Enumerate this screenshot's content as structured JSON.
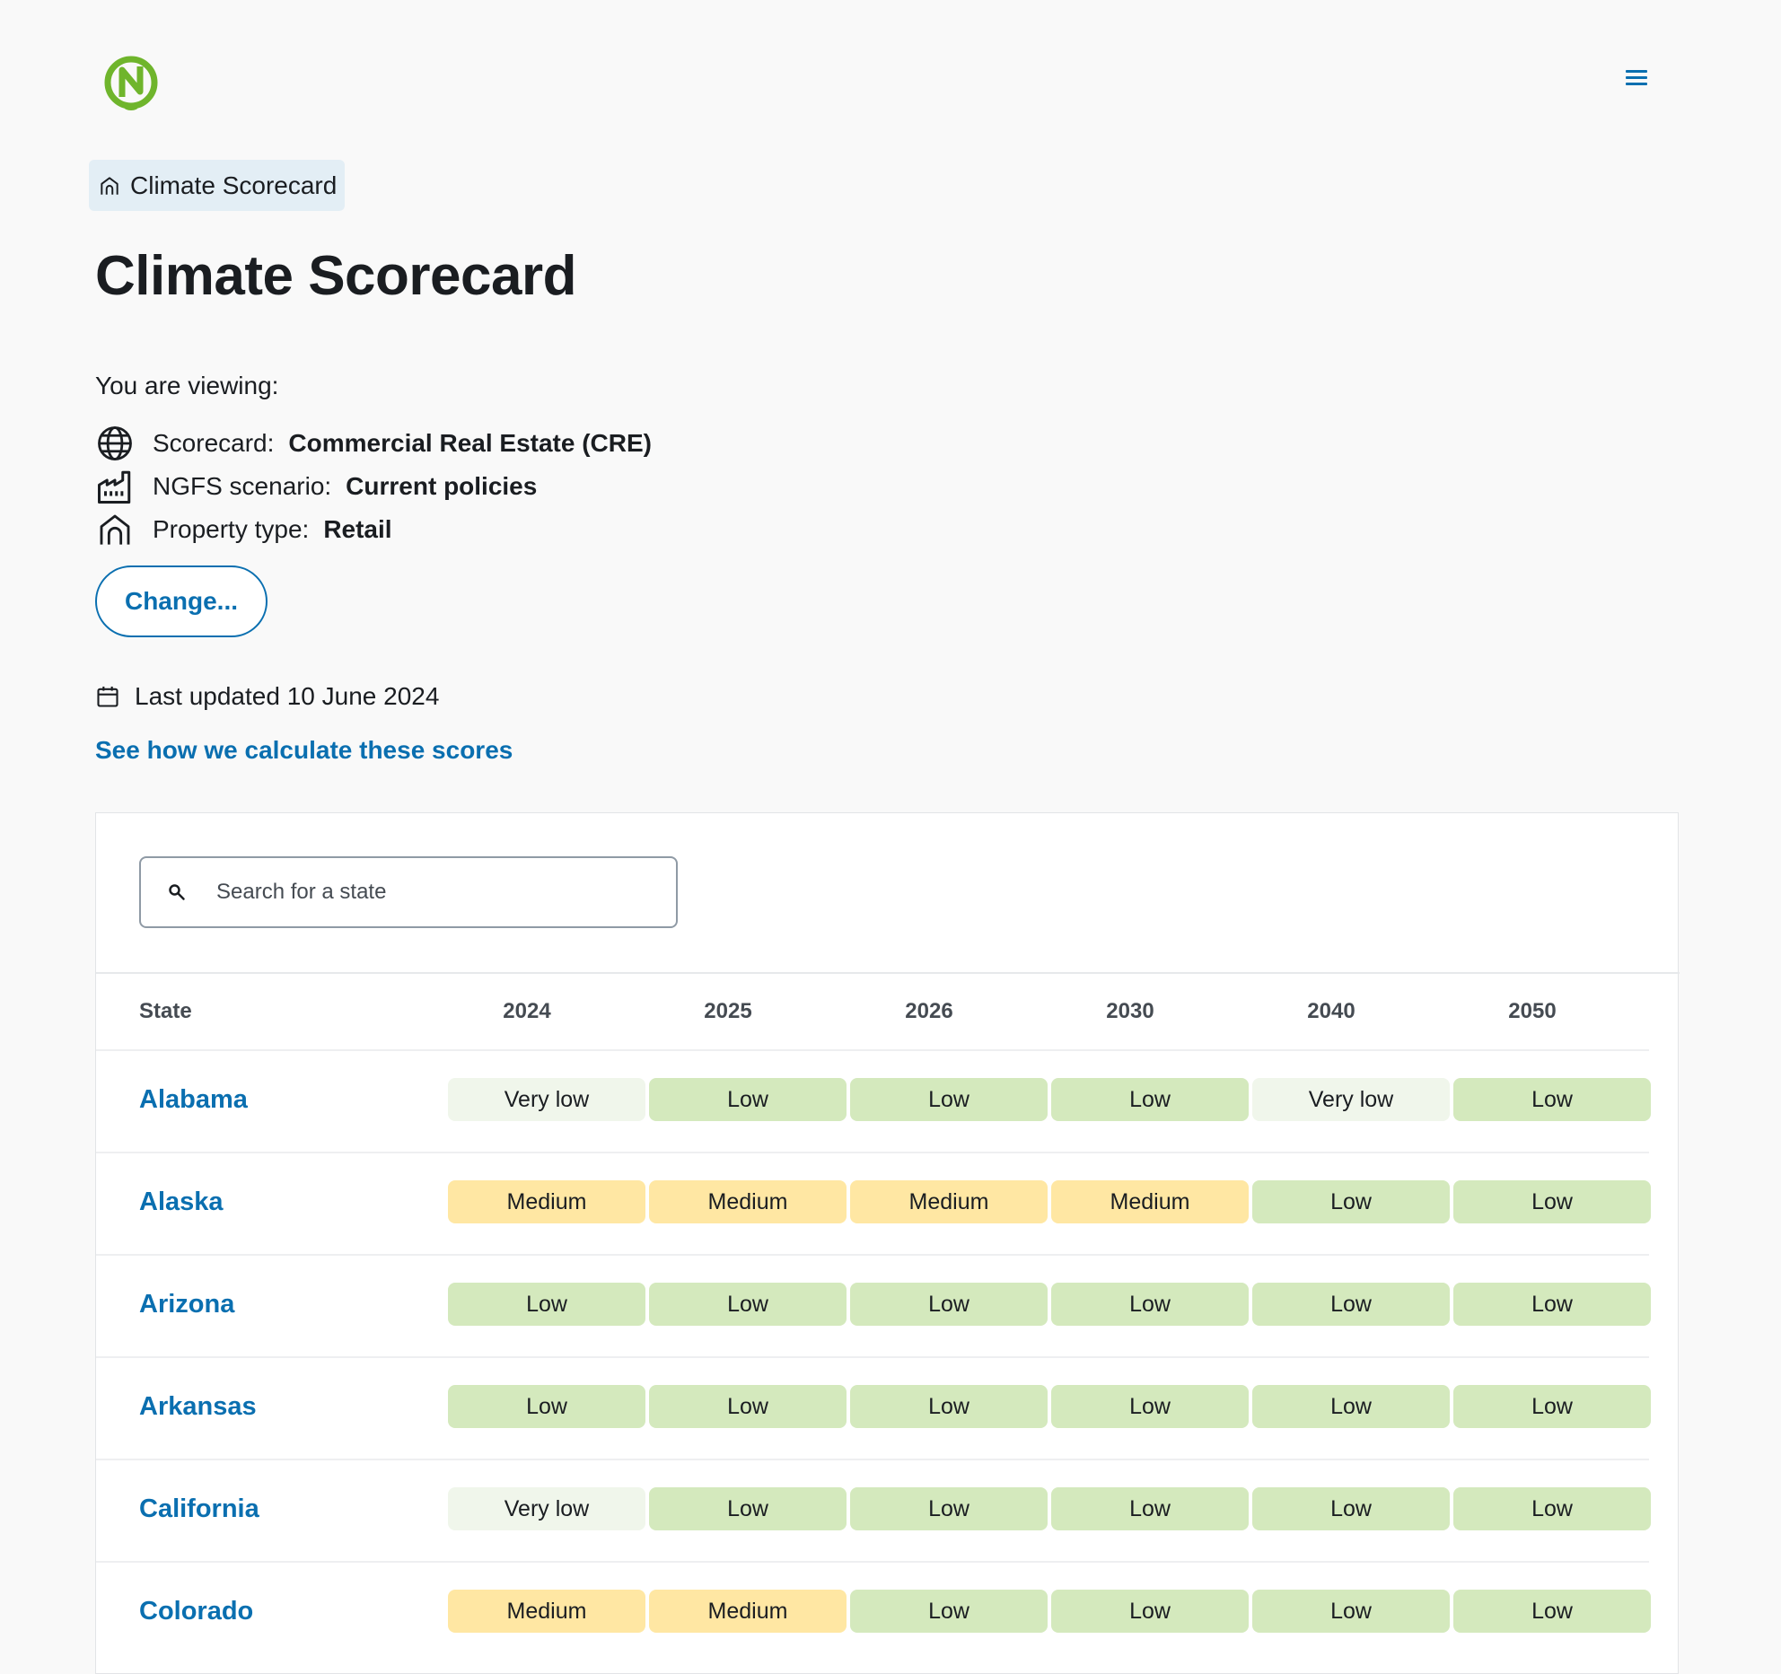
{
  "breadcrumb": {
    "label": "Climate Scorecard"
  },
  "page": {
    "title": "Climate Scorecard"
  },
  "viewing": {
    "heading": "You are viewing:",
    "scorecard_label": "Scorecard:",
    "scorecard_value": "Commercial Real Estate (CRE)",
    "scenario_label": "NGFS scenario:",
    "scenario_value": "Current policies",
    "property_label": "Property type:",
    "property_value": "Retail"
  },
  "change_button": "Change...",
  "last_updated": "Last updated 10 June 2024",
  "calc_link": "See how we calculate these scores",
  "search": {
    "placeholder": "Search for a state"
  },
  "table": {
    "headers": [
      "State",
      "2024",
      "2025",
      "2026",
      "2030",
      "2040",
      "2050"
    ],
    "rows": [
      {
        "state": "Alabama",
        "scores": [
          "Very low",
          "Low",
          "Low",
          "Low",
          "Very low",
          "Low"
        ]
      },
      {
        "state": "Alaska",
        "scores": [
          "Medium",
          "Medium",
          "Medium",
          "Medium",
          "Low",
          "Low"
        ]
      },
      {
        "state": "Arizona",
        "scores": [
          "Low",
          "Low",
          "Low",
          "Low",
          "Low",
          "Low"
        ]
      },
      {
        "state": "Arkansas",
        "scores": [
          "Low",
          "Low",
          "Low",
          "Low",
          "Low",
          "Low"
        ]
      },
      {
        "state": "California",
        "scores": [
          "Very low",
          "Low",
          "Low",
          "Low",
          "Low",
          "Low"
        ]
      },
      {
        "state": "Colorado",
        "scores": [
          "Medium",
          "Medium",
          "Low",
          "Low",
          "Low",
          "Low"
        ]
      }
    ]
  },
  "colors": {
    "accent": "#0a6fb0",
    "very_low": "#f0f6eb",
    "low": "#d4e9bd",
    "medium": "#ffe7a3",
    "logo_green": "#6fb52c"
  },
  "icons": {
    "logo": "n-logo",
    "menu": "hamburger-menu-icon",
    "breadcrumb": "home-icon",
    "scorecard": "globe-icon",
    "scenario": "factory-icon",
    "property": "home-icon",
    "updated": "calendar-icon",
    "search": "search-icon"
  }
}
